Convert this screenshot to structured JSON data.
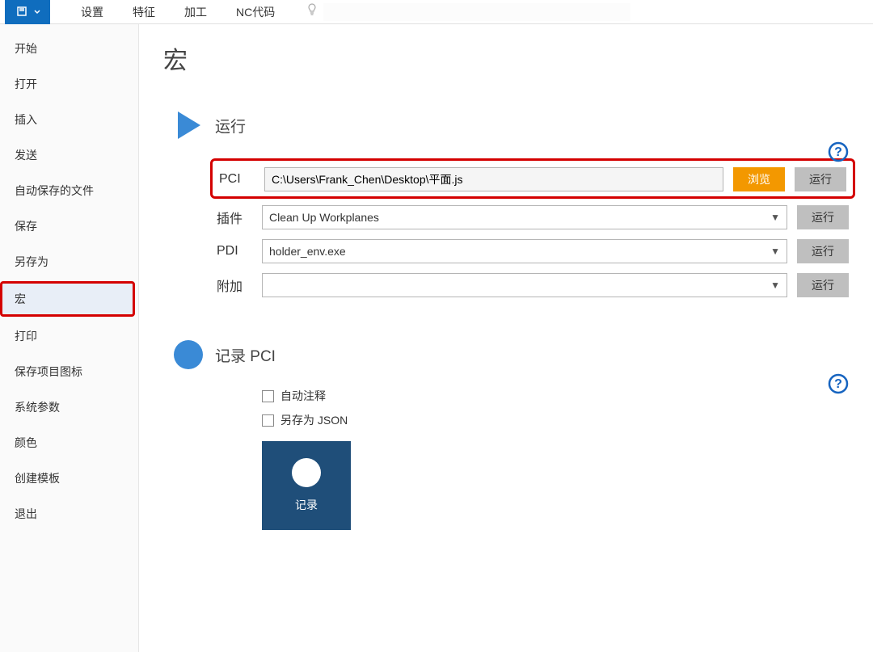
{
  "menubar": {
    "items": [
      "设置",
      "特征",
      "加工",
      "NC代码"
    ],
    "search_placeholder": ""
  },
  "sidebar": {
    "items": [
      "开始",
      "打开",
      "插入",
      "发送",
      "自动保存的文件",
      "保存",
      "另存为",
      "宏",
      "打印",
      "保存项目图标",
      "系统参数",
      "颜色",
      "创建模板",
      "退出"
    ],
    "active_index": 7
  },
  "page": {
    "title": "宏"
  },
  "run_section": {
    "title": "运行",
    "rows": {
      "pci": {
        "label": "PCI",
        "value": "C:\\Users\\Frank_Chen\\Desktop\\平面.js",
        "browse": "浏览",
        "run": "运行"
      },
      "plugin": {
        "label": "插件",
        "value": "Clean Up Workplanes",
        "run": "运行"
      },
      "pdi": {
        "label": "PDI",
        "value": "holder_env.exe",
        "run": "运行"
      },
      "addon": {
        "label": "附加",
        "value": "",
        "run": "运行"
      }
    }
  },
  "record_section": {
    "title": "记录 PCI",
    "auto_comment": "自动注释",
    "save_json": "另存为 JSON",
    "record_button": "记录"
  }
}
